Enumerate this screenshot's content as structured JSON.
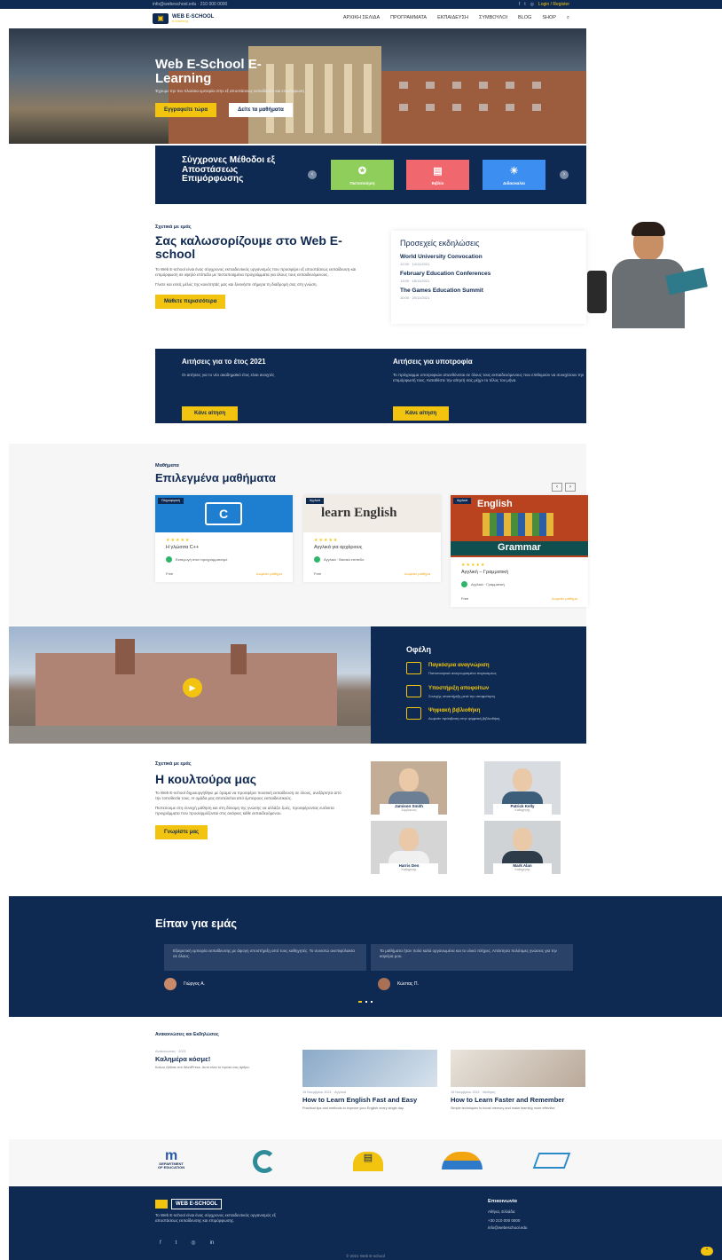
{
  "topbar": {
    "contact": "info@webeschool.edu  ·  210 000 0000",
    "login": "Login / Register"
  },
  "header": {
    "logo_text": "WEB E-SCHOOL",
    "logo_sub": "e-learning",
    "nav": [
      "ΑΡΧΙΚΗ ΣΕΛΙΔΑ",
      "ΠΡΟΓΡΑΜΜΑΤΑ",
      "ΕΚΠΑΙΔΕΥΣΗ",
      "ΣΥΜΒΟΥΛΟΙ",
      "BLOG",
      "SHOP"
    ]
  },
  "hero": {
    "title": "Web E-School E-Learning",
    "text": "Έχουμε την πιο πλούσια εμπειρία στην εξ αποστάσεως εκπαίδευση και επιμόρφωση",
    "btn1": "Εγγραφείτε τώρα",
    "btn2": "Δείτε τα μαθήματα"
  },
  "methods": {
    "title": "Σύγχρονες Μέθοδοι εξ Αποστάσεως Επιμόρφωσης",
    "cards": [
      "Πιστοποίηση",
      "Βιβλίο",
      "Διδασκαλία"
    ],
    "colors": [
      "#8fce5a",
      "#f0686e",
      "#3c8ef0"
    ]
  },
  "welcome": {
    "label": "Σχετικά με εμάς",
    "title": "Σας καλωσορίζουμε στο Web E-school",
    "p1": "Το Web E-school είναι ένας σύγχρονος εκπαιδευτικός οργανισμός που προσφέρει εξ αποστάσεως εκπαίδευση και επιμόρφωση σε υψηλό επίπεδο με πιστοποιημένα προγράμματα για όλους τους εκπαιδευόμενους.",
    "p2": "Γίνετε και εσείς μέλος της κοινότητάς μας και ξεκινήστε σήμερα τη διαδρομή σας στη γνώση.",
    "btn": "Μάθετε περισσότερα"
  },
  "events": {
    "title": "Προσεχείς εκδηλώσεις",
    "items": [
      {
        "name": "World University Convocation",
        "date": "12:00 · 14/11/2021"
      },
      {
        "name": "February Education Conferences",
        "date": "13:00 · 18/11/2021"
      },
      {
        "name": "The Games Education Summit",
        "date": "10:00 · 20/11/2021"
      }
    ]
  },
  "applications": {
    "left_title": "Αιτήσεις για το έτος 2021",
    "left_text": "Οι αιτήσεις για το νέο ακαδημαϊκό έτος είναι ανοιχτές",
    "left_btn": "Κάνε αίτηση",
    "right_title": "Αιτήσεις για υποτροφία",
    "right_text": "Το πρόγραμμα υποτροφιών απευθύνεται σε όλους τους εκπαιδευόμενους που επιθυμούν να συνεχίσουν την επιμόρφωσή τους. Καταθέστε την αίτησή σας μέχρι το τέλος του μήνα.",
    "right_btn": "Κάνε αίτηση"
  },
  "courses": {
    "label": "Μαθήματα",
    "title": "Επιλεγμένα μαθήματα",
    "items": [
      {
        "badge": "Πληροφορική",
        "title": "Η γλώσσα C++",
        "author": "Εισαγωγή στον προγραμματισμό",
        "price": "Free",
        "students": "Δωρεάν μάθημα"
      },
      {
        "badge": "Αγγλικά",
        "title": "Αγγλικά για αρχάριους",
        "author": "Αγγλικά · Βασικό επίπεδο",
        "price": "Free",
        "students": "Δωρεάν μάθημα"
      },
      {
        "badge": "Αγγλικά",
        "title": "Αγγλική – Γραμματική",
        "author": "Αγγλικά · Γραμματική",
        "price": "Free",
        "students": "Δωρεάν μάθημα"
      }
    ]
  },
  "benefits": {
    "title": "Οφέλη",
    "items": [
      {
        "name": "Παγκόσμια αναγνώριση",
        "text": "Πιστοποιητικά αναγνωρισμένα παγκοσμίως"
      },
      {
        "name": "Υποστήριξη αποφοίτων",
        "text": "Συνεχής υποστήριξη μετά την αποφοίτηση"
      },
      {
        "name": "Ψηφιακή βιβλιοθήκη",
        "text": "Δωρεάν πρόσβαση στην ψηφιακή βιβλιοθήκη"
      }
    ]
  },
  "culture": {
    "label": "Σχετικά με εμάς",
    "title": "Η κουλτούρα μας",
    "p1": "Το Web E-school δημιουργήθηκε με όραμα να προσφέρει ποιοτική εκπαίδευση σε όλους, ανεξάρτητα από την τοποθεσία τους. Η ομάδα μας αποτελείται από έμπειρους εκπαιδευτικούς.",
    "p2": "Πιστεύουμε στη συνεχή μάθηση και στη δύναμη της γνώσης να αλλάζει ζωές, προσφέροντας ευέλικτα προγράμματα που προσαρμόζονται στις ανάγκες κάθε εκπαιδευόμενου.",
    "btn": "Γνωρίστε μας",
    "team": [
      {
        "name": "Jamison Smith",
        "role": "Σύμβουλος"
      },
      {
        "name": "Patrick Kelly",
        "role": "Καθηγητής"
      },
      {
        "name": "Harris Den",
        "role": "Καθηγητής"
      },
      {
        "name": "Mark Alan",
        "role": "Καθηγητής"
      }
    ]
  },
  "testimonials": {
    "title": "Είπαν για εμάς",
    "items": [
      {
        "text": "Εξαιρετική εμπειρία εκπαίδευσης με άψογη υποστήριξη από τους καθηγητές. Το συνιστώ ανεπιφύλακτα σε όλους.",
        "name": "Γιώργος Α."
      },
      {
        "text": "Τα μαθήματα ήταν πολύ καλά οργανωμένα και το υλικό πλήρες. Απέκτησα πολύτιμες γνώσεις για την καριέρα μου.",
        "name": "Κώστας Π."
      }
    ]
  },
  "news": {
    "label": "Ανακοινώσεις και Εκδηλώσεις",
    "items": [
      {
        "meta": "Ανακοινώσεις · 2021",
        "title": "Καλημέρα κόσμε!",
        "text": "Καλώς ήλθατε στο WordPress. Αυτό είναι το πρώτο σας άρθρο."
      },
      {
        "meta": "15 Νοεμβρίου 2021 · Αγγλικά",
        "title": "How to Learn English Fast and Easy",
        "text": "Practical tips and methods to improve your English every single day."
      },
      {
        "meta": "15 Νοεμβρίου 2021 · Μάθηση",
        "title": "How to Learn Faster and Remember",
        "text": "Simple techniques to boost memory and make learning more effective."
      }
    ]
  },
  "partners": {
    "dept_line1": "DEPARTMENT",
    "dept_line2": "OF EDUCATION"
  },
  "footer": {
    "logo": "WEB E-SCHOOL",
    "text": "Το Web E-school είναι ένας σύγχρονος εκπαιδευτικός οργανισμός εξ αποστάσεως εκπαίδευσης και επιμόρφωσης.",
    "contact_title": "Επικοινωνία",
    "address": "Αθήνα, Ελλάδα",
    "phone": "+30 210 000 0000",
    "email": "info@webeschool.edu",
    "copyright": "© 2021 Web E-school"
  }
}
